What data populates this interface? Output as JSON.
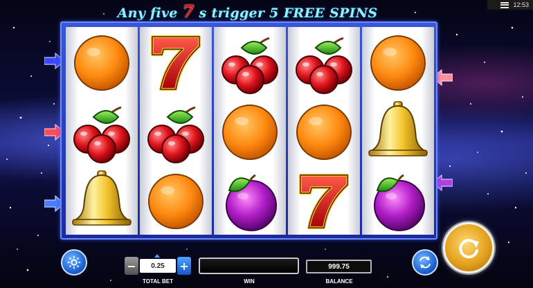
{
  "header": {
    "title_prefix": "Any five",
    "title_seven": "7",
    "title_suffix": "s trigger 5 FREE SPINS",
    "menu_icon": "hamburger-menu-icon",
    "clock": "12:53"
  },
  "reels": [
    [
      "orange",
      "cherry",
      "bell"
    ],
    [
      "seven",
      "cherry",
      "orange"
    ],
    [
      "cherry",
      "orange",
      "plum"
    ],
    [
      "cherry",
      "orange",
      "seven"
    ],
    [
      "orange",
      "bell",
      "plum"
    ]
  ],
  "paylines": {
    "left_arrow_colors": [
      "#3b47ff",
      "#ff4a5c",
      "#4a7dff"
    ],
    "right_arrow_colors": [
      "#ff8fa0",
      "#b040e0"
    ]
  },
  "controls": {
    "settings_icon": "gear-icon",
    "total_bet_value": "0.25",
    "total_bet_label": "TOTAL BET",
    "minus_label": "−",
    "plus_label": "+",
    "win_label": "WIN",
    "balance_value": "999.75",
    "balance_label": "BALANCE",
    "autoplay_icon": "autoplay-icon",
    "spin_icon": "spin-icon"
  }
}
